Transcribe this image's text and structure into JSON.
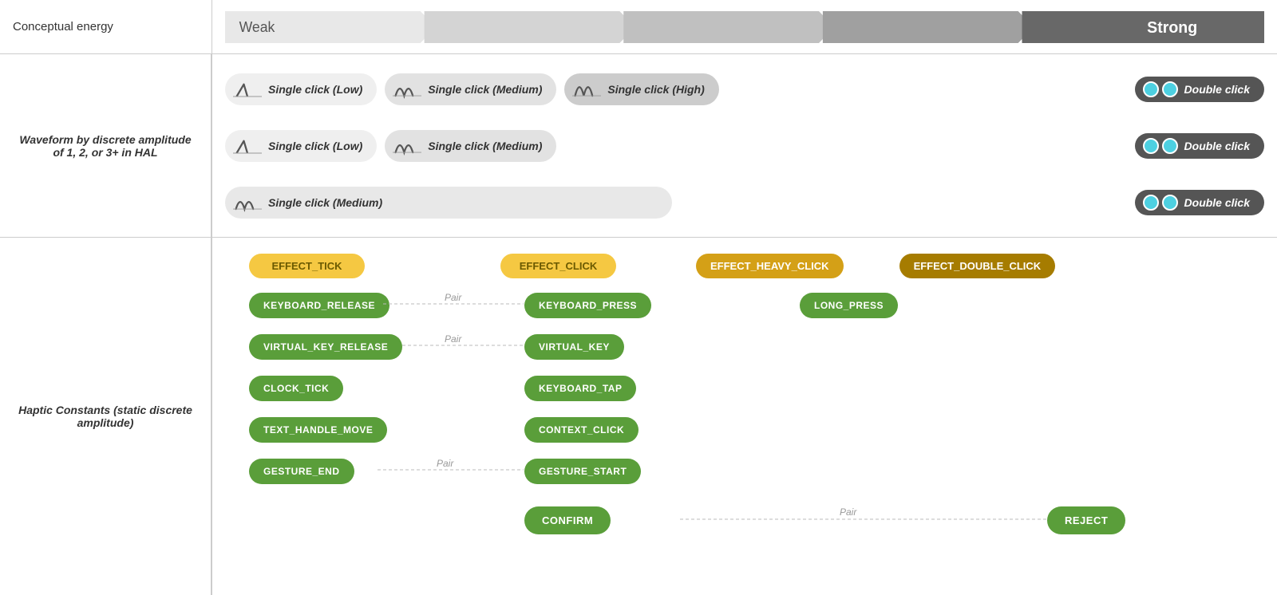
{
  "conceptual_energy": {
    "label": "Conceptual energy",
    "weak": "Weak",
    "strong": "Strong"
  },
  "waveform_label": "Waveform by discrete amplitude of 1, 2, or 3+ in HAL",
  "haptic_label": "Haptic Constants (static discrete amplitude)",
  "waveforms": {
    "row1": {
      "pill1": {
        "label": "Single click (Low)",
        "type": "low"
      },
      "pill2": {
        "label": "Single click (Medium)",
        "type": "medium"
      },
      "pill3": {
        "label": "Single click (High)",
        "type": "high"
      },
      "pill4": {
        "label": "Double click",
        "type": "double"
      }
    },
    "row2": {
      "pill1": {
        "label": "Single click (Low)",
        "type": "low"
      },
      "pill2": {
        "label": "Single click (Medium)",
        "type": "medium"
      },
      "pill3": {
        "label": "Double click",
        "type": "double"
      }
    },
    "row3": {
      "pill1": {
        "label": "Single click (Medium)",
        "type": "medium"
      },
      "pill2": {
        "label": "Double click",
        "type": "double"
      }
    }
  },
  "effects": {
    "tick": "EFFECT_TICK",
    "click": "EFFECT_CLICK",
    "heavy_click": "EFFECT_HEAVY_CLICK",
    "double_click": "EFFECT_DOUBLE_CLICK"
  },
  "haptic_constants": {
    "col1": [
      "KEYBOARD_RELEASE",
      "VIRTUAL_KEY_RELEASE",
      "CLOCK_TICK",
      "TEXT_HANDLE_MOVE",
      "GESTURE_END"
    ],
    "col2": [
      "KEYBOARD_PRESS",
      "VIRTUAL_KEY",
      "KEYBOARD_TAP",
      "CONTEXT_CLICK",
      "GESTURE_START",
      "CONFIRM"
    ],
    "col3": [
      "LONG_PRESS"
    ],
    "col4": [
      "REJECT"
    ]
  },
  "pair_labels": [
    "Pair",
    "Pair",
    "Pair",
    "Pair"
  ],
  "confirm_btn": "CONFIRM",
  "reject_btn": "REJECT"
}
